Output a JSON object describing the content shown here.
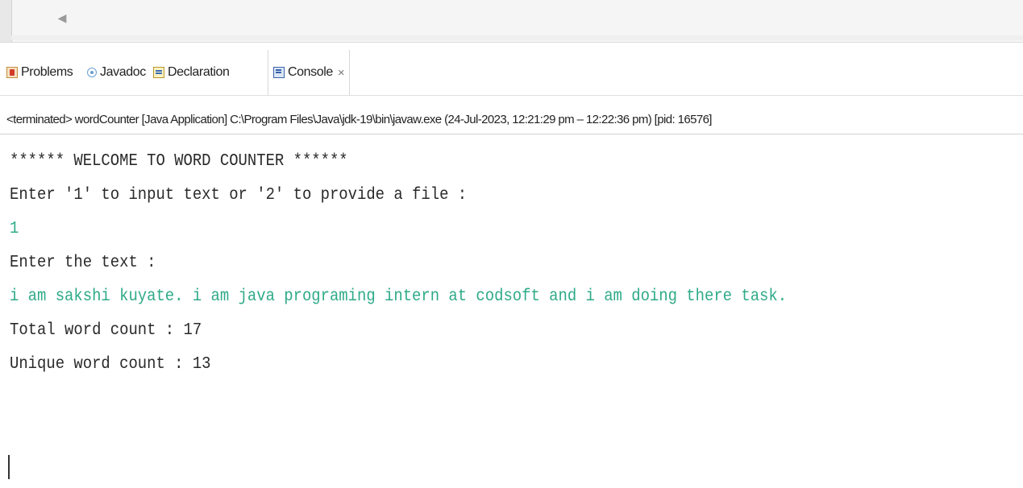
{
  "top": {
    "scroll_arrow": "◀"
  },
  "tabs": [
    {
      "label": "Problems",
      "icon": "problems-icon"
    },
    {
      "label": "Javadoc",
      "icon": "javadoc-icon"
    },
    {
      "label": "Declaration",
      "icon": "declaration-icon"
    },
    {
      "label": "Console",
      "icon": "console-icon",
      "active": true,
      "close": "×"
    }
  ],
  "status": "<terminated> wordCounter [Java Application] C:\\Program Files\\Java\\jdk-19\\bin\\javaw.exe (24-Jul-2023, 12:21:29 pm – 12:22:36 pm) [pid: 16576]",
  "console": {
    "lines": [
      {
        "text": "****** WELCOME TO WORD COUNTER ******",
        "kind": "output"
      },
      {
        "text": "Enter '1' to input text or '2' to provide a file :",
        "kind": "output"
      },
      {
        "text": "1",
        "kind": "input"
      },
      {
        "text": "Enter the text :",
        "kind": "output"
      },
      {
        "text": "i am sakshi kuyate. i am java programing intern at codsoft and i am doing there task.",
        "kind": "input"
      },
      {
        "text": "Total word count : 17",
        "kind": "output"
      },
      {
        "text": "Unique word count : 13",
        "kind": "output"
      }
    ]
  },
  "colors": {
    "input_text": "#2eaa88",
    "output_text": "#2a2a2a"
  }
}
